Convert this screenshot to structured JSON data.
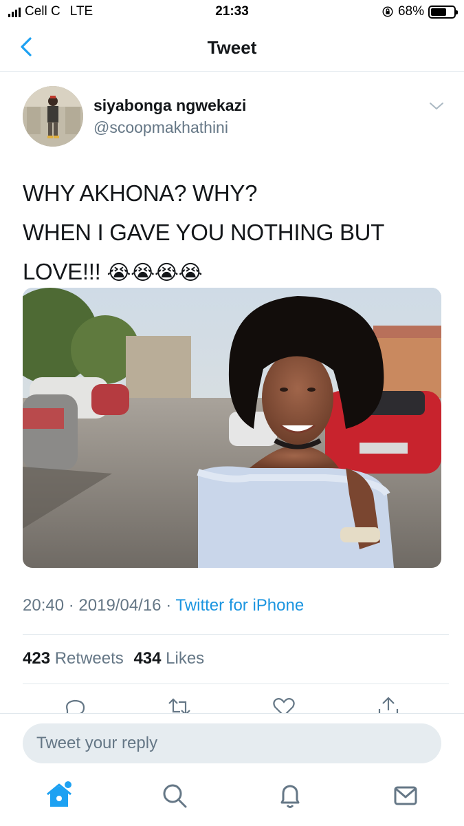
{
  "status_bar": {
    "carrier": "Cell C",
    "network": "LTE",
    "time": "21:33",
    "battery": "68%",
    "battery_level": 0.68
  },
  "header": {
    "title": "Tweet"
  },
  "tweet": {
    "author_name": "siyabonga ngwekazi",
    "author_handle": "@scoopmakhathini",
    "text_lines": [
      "WHY AKHONA? WHY?",
      "WHEN I GAVE YOU NOTHING BUT",
      "LOVE!!!"
    ],
    "emojis": "😭😭😭😭",
    "time": "20:40",
    "date": "2019/04/16",
    "source": "Twitter for iPhone",
    "retweet_count": "423",
    "retweet_label": "Retweets",
    "like_count": "434",
    "like_label": "Likes"
  },
  "composer": {
    "placeholder": "Tweet your reply"
  },
  "tab_bar": {
    "active_tab": "home",
    "accent_color": "#1da1f2",
    "icons": [
      "home-icon",
      "search-icon",
      "notifications-icon",
      "messages-icon"
    ]
  },
  "colors": {
    "link": "#1b95e0",
    "secondary_text": "#657786",
    "primary_text": "#14171a"
  }
}
